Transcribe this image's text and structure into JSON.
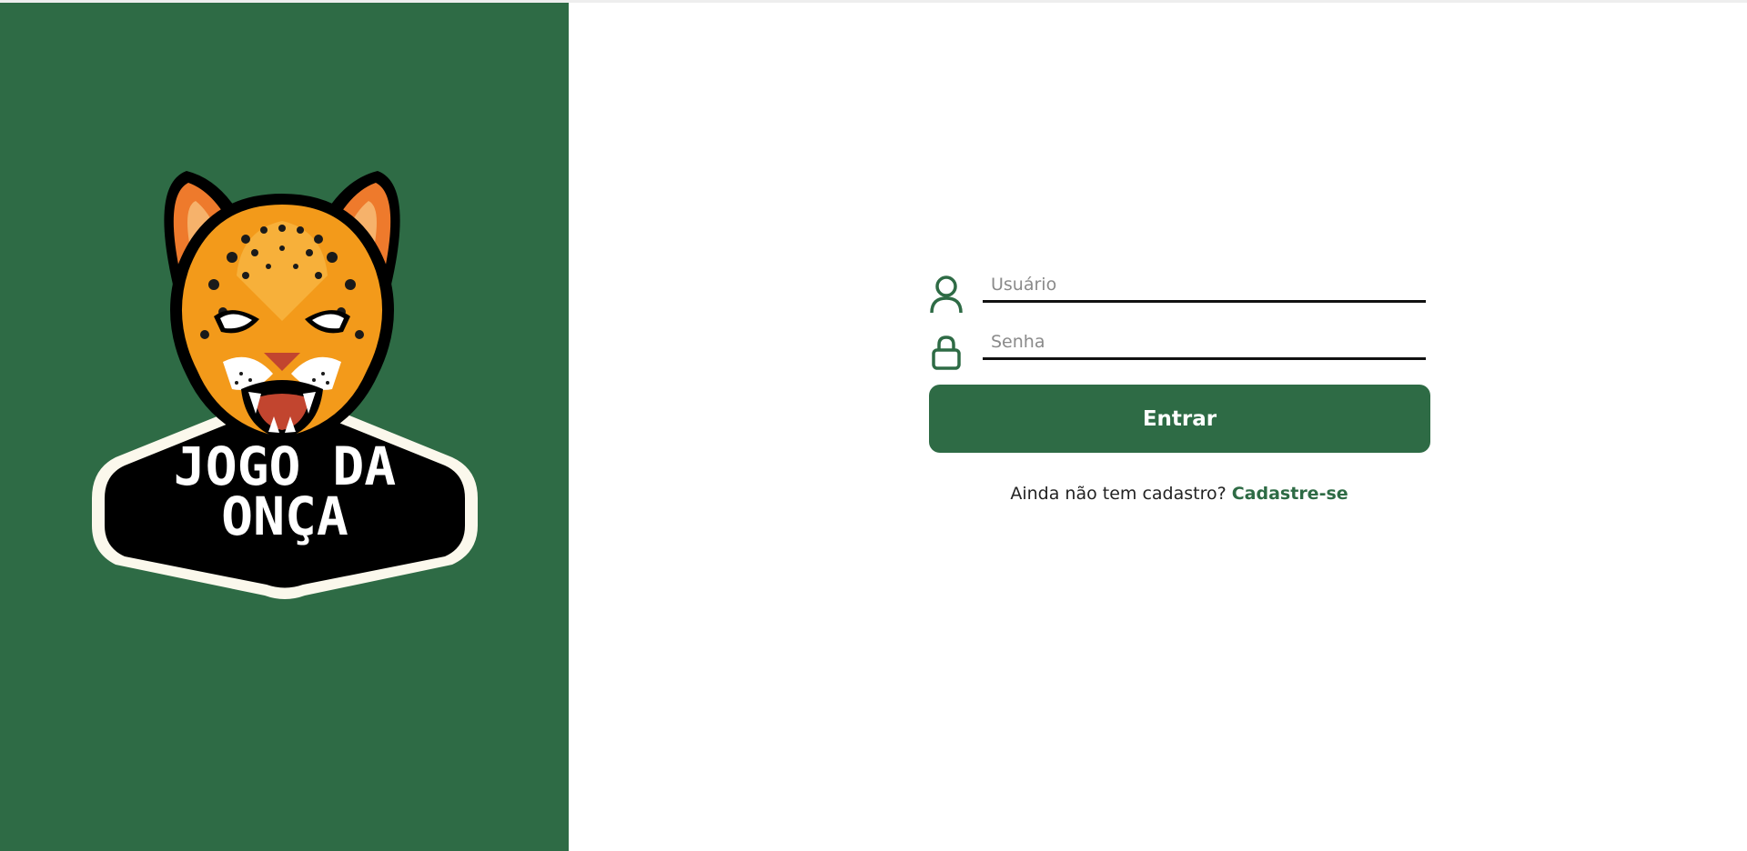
{
  "brand": {
    "logo_line1": "JOGO DA",
    "logo_line2": "ONÇA",
    "colors": {
      "primary": "#2e6b45",
      "jaguar_orange": "#f39a1a",
      "ear_orange": "#ee7a2c",
      "badge_black": "#000000",
      "badge_border": "#fbf8ec"
    }
  },
  "login": {
    "username": {
      "placeholder": "Usuário",
      "value": "",
      "icon": "user-icon"
    },
    "password": {
      "placeholder": "Senha",
      "value": "",
      "icon": "lock-icon"
    },
    "submit_label": "Entrar",
    "signup_prompt": "Ainda não tem cadastro?",
    "signup_link": "Cadastre-se"
  }
}
